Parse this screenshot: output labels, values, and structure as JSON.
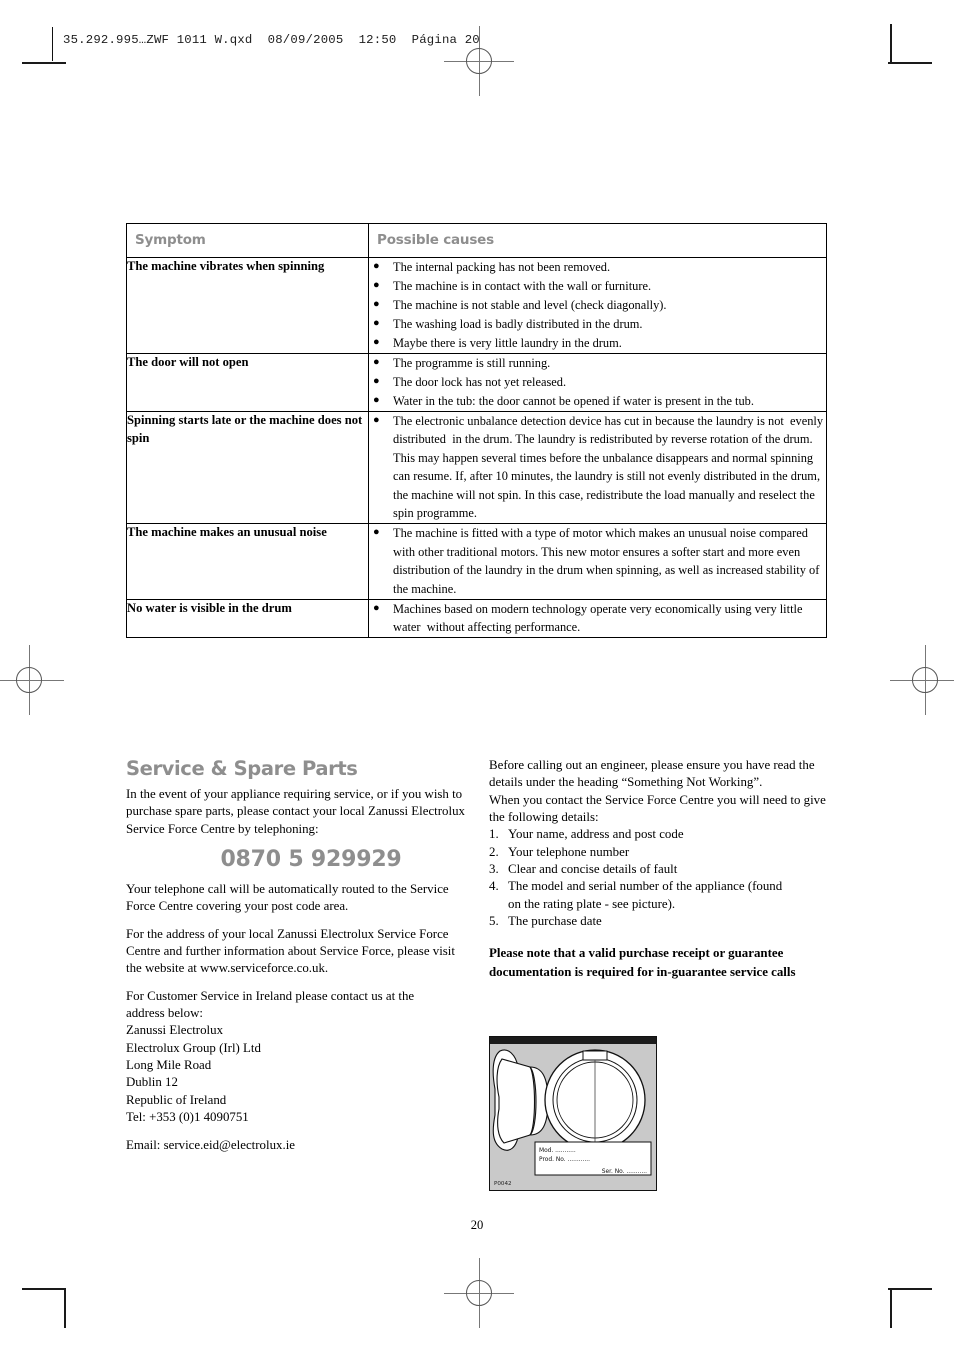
{
  "page": {
    "slug": "35.292.995…ZWF 1011 W.qxd  08/09/2005  12:50  Página 20",
    "folio": "20",
    "header_gray": "#8e8e8e"
  },
  "table": {
    "headers": [
      "Symptom",
      "Possible causes"
    ],
    "rows": [
      {
        "symptom": "The machine vibrates when spinning",
        "causes": [
          "The internal packing has not been removed.",
          "The machine is in contact with the wall or furniture.",
          "The machine is not stable and level (check diagonally).",
          "The washing load is badly distributed in the drum.",
          "Maybe there is very little laundry in the drum."
        ]
      },
      {
        "symptom": "The door will not open",
        "causes": [
          "The programme is still running.",
          "The door lock has not yet released.",
          "Water in the tub: the door cannot be opened if water is present in the tub."
        ]
      },
      {
        "symptom": "Spinning starts late or the machine does not spin",
        "causes": [
          "The electronic unbalance detection device has cut in because the laundry is not  evenly distributed  in the drum. The laundry is redistributed by reverse rotation of the drum. This may happen several times before the unbalance disappears and normal spinning can resume. If, after 10 minutes, the laundry is still not evenly distributed in the drum, the machine will not spin. In this case, redistribute the load manually and reselect the spin programme."
        ]
      },
      {
        "symptom": "The machine makes an unusual noise",
        "causes": [
          "The machine is fitted with a type of motor which makes an unusual noise compared with other traditional motors. This new motor ensures a softer start and more even distribution of the laundry in the drum when spinning, as well as increased stability of the machine."
        ]
      },
      {
        "symptom": "No water is visible in the drum",
        "causes": [
          "Machines based on modern technology operate very economically using very little water  without affecting performance."
        ]
      }
    ]
  },
  "service": {
    "heading": "Service & Spare Parts",
    "intro": "In the event of your appliance requiring service, or if you wish to purchase spare parts, please contact your local Zanussi Electrolux Service Force Centre by telephoning:",
    "phone": "0870 5 929929",
    "routing": "Your telephone call will be automatically routed to the Service Force Centre covering your post code area.",
    "website_para": "For the address of your local Zanussi Electrolux Service Force Centre and further information about Service Force, please visit the website at www.serviceforce.co.uk.",
    "ireland_intro": "For Customer Service in Ireland please contact us at the",
    "ireland_address": "address below:\nZanussi Electrolux\nElectrolux Group (Irl) Ltd\nLong Mile Road\nDublin 12\nRepublic of Ireland\nTel: +353 (0)1 4090751",
    "ireland_email": "Email: service.eid@electrolux.ie"
  },
  "before_calling": {
    "para1": "Before calling out an engineer, please ensure you have read the details under the heading “Something Not Working”.",
    "para2": "When you contact the Service Force Centre you will need to give the following details:",
    "details": [
      {
        "num": "1.",
        "text": "Your name, address and post code"
      },
      {
        "num": "2.",
        "text": "Your telephone number"
      },
      {
        "num": "3.",
        "text": "Clear and concise details of fault"
      },
      {
        "num": "4.",
        "text": "The model and serial number of the appliance (found\n   on the rating plate - see picture)."
      },
      {
        "num": "5.",
        "text": "The purchase date"
      }
    ],
    "note": "Please note that a valid purchase receipt or guarantee documentation is required for in-guarantee service calls"
  },
  "illustration": {
    "name": "washing-machine-rating-plate",
    "plate_lines": [
      "Mod. ...........",
      "Prod. No. ............"
    ],
    "plate_serial": "Ser. No. ...........",
    "figure_code": "P0042",
    "background": "#c9c9c9"
  }
}
